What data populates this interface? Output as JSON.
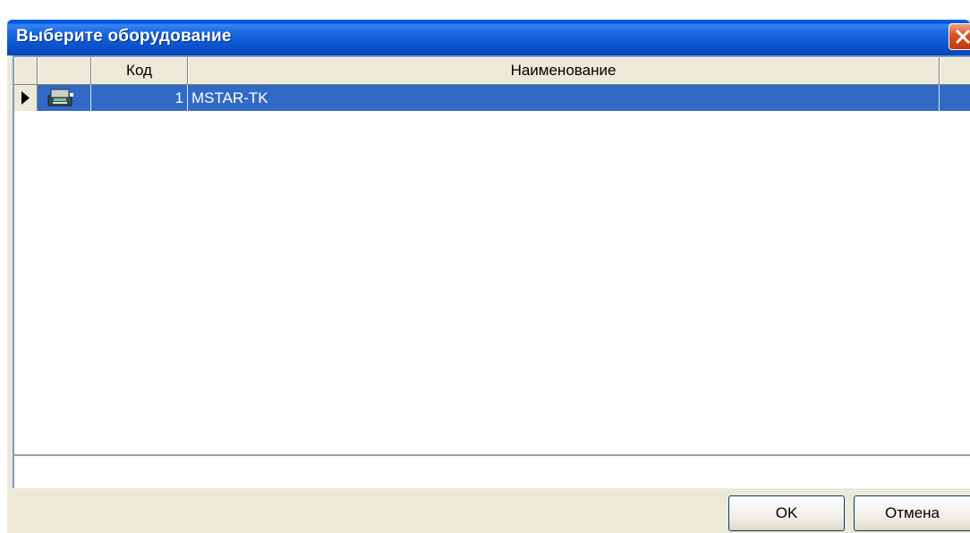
{
  "window": {
    "title": "Выберите оборудование"
  },
  "grid": {
    "columns": [
      "",
      "",
      "Код",
      "Наименование",
      ""
    ],
    "rows": [
      {
        "code": "1",
        "name": "MSTAR-TK",
        "selected": true
      }
    ]
  },
  "buttons": {
    "ok_label": "OK",
    "cancel_label": "Отмена"
  },
  "colors": {
    "titlebar": "#0a55d0",
    "selection": "#316ac5",
    "face": "#ece9d8"
  },
  "icons": {
    "row_indicator": "triangle-right-icon",
    "row_type": "equipment-icon",
    "close": "close-icon"
  }
}
